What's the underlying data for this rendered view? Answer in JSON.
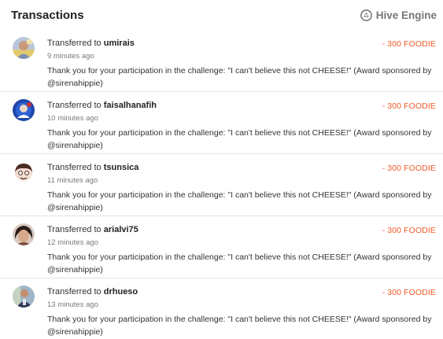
{
  "header": {
    "title": "Transactions",
    "brand": "Hive Engine",
    "brand_icon": "hive-engine-icon"
  },
  "colors": {
    "amount": "#ef5a28",
    "divider": "#e3e3e3"
  },
  "transactions": [
    {
      "prefix": "Transferred to",
      "user": "umirais",
      "time": "9 minutes ago",
      "amount": "- 300 FOODIE",
      "memo": "Thank you for your participation in the challenge: \"I can't believe this not CHEESE!\" (Award sponsored by @sirenahippie)"
    },
    {
      "prefix": "Transferred to",
      "user": "faisalhanafih",
      "time": "10 minutes ago",
      "amount": "- 300 FOODIE",
      "memo": "Thank you for your participation in the challenge: \"I can't believe this not CHEESE!\" (Award sponsored by @sirenahippie)"
    },
    {
      "prefix": "Transferred to",
      "user": "tsunsica",
      "time": "11 minutes ago",
      "amount": "- 300 FOODIE",
      "memo": "Thank you for your participation in the challenge: \"I can't believe this not CHEESE!\" (Award sponsored by @sirenahippie)"
    },
    {
      "prefix": "Transferred to",
      "user": "arialvi75",
      "time": "12 minutes ago",
      "amount": "- 300 FOODIE",
      "memo": "Thank you for your participation in the challenge: \"I can't believe this not CHEESE!\" (Award sponsored by @sirenahippie)"
    },
    {
      "prefix": "Transferred to",
      "user": "drhueso",
      "time": "13 minutes ago",
      "amount": "- 300 FOODIE",
      "memo": "Thank you for your participation in the challenge: \"I can't believe this not CHEESE!\" (Award sponsored by @sirenahippie)"
    }
  ]
}
